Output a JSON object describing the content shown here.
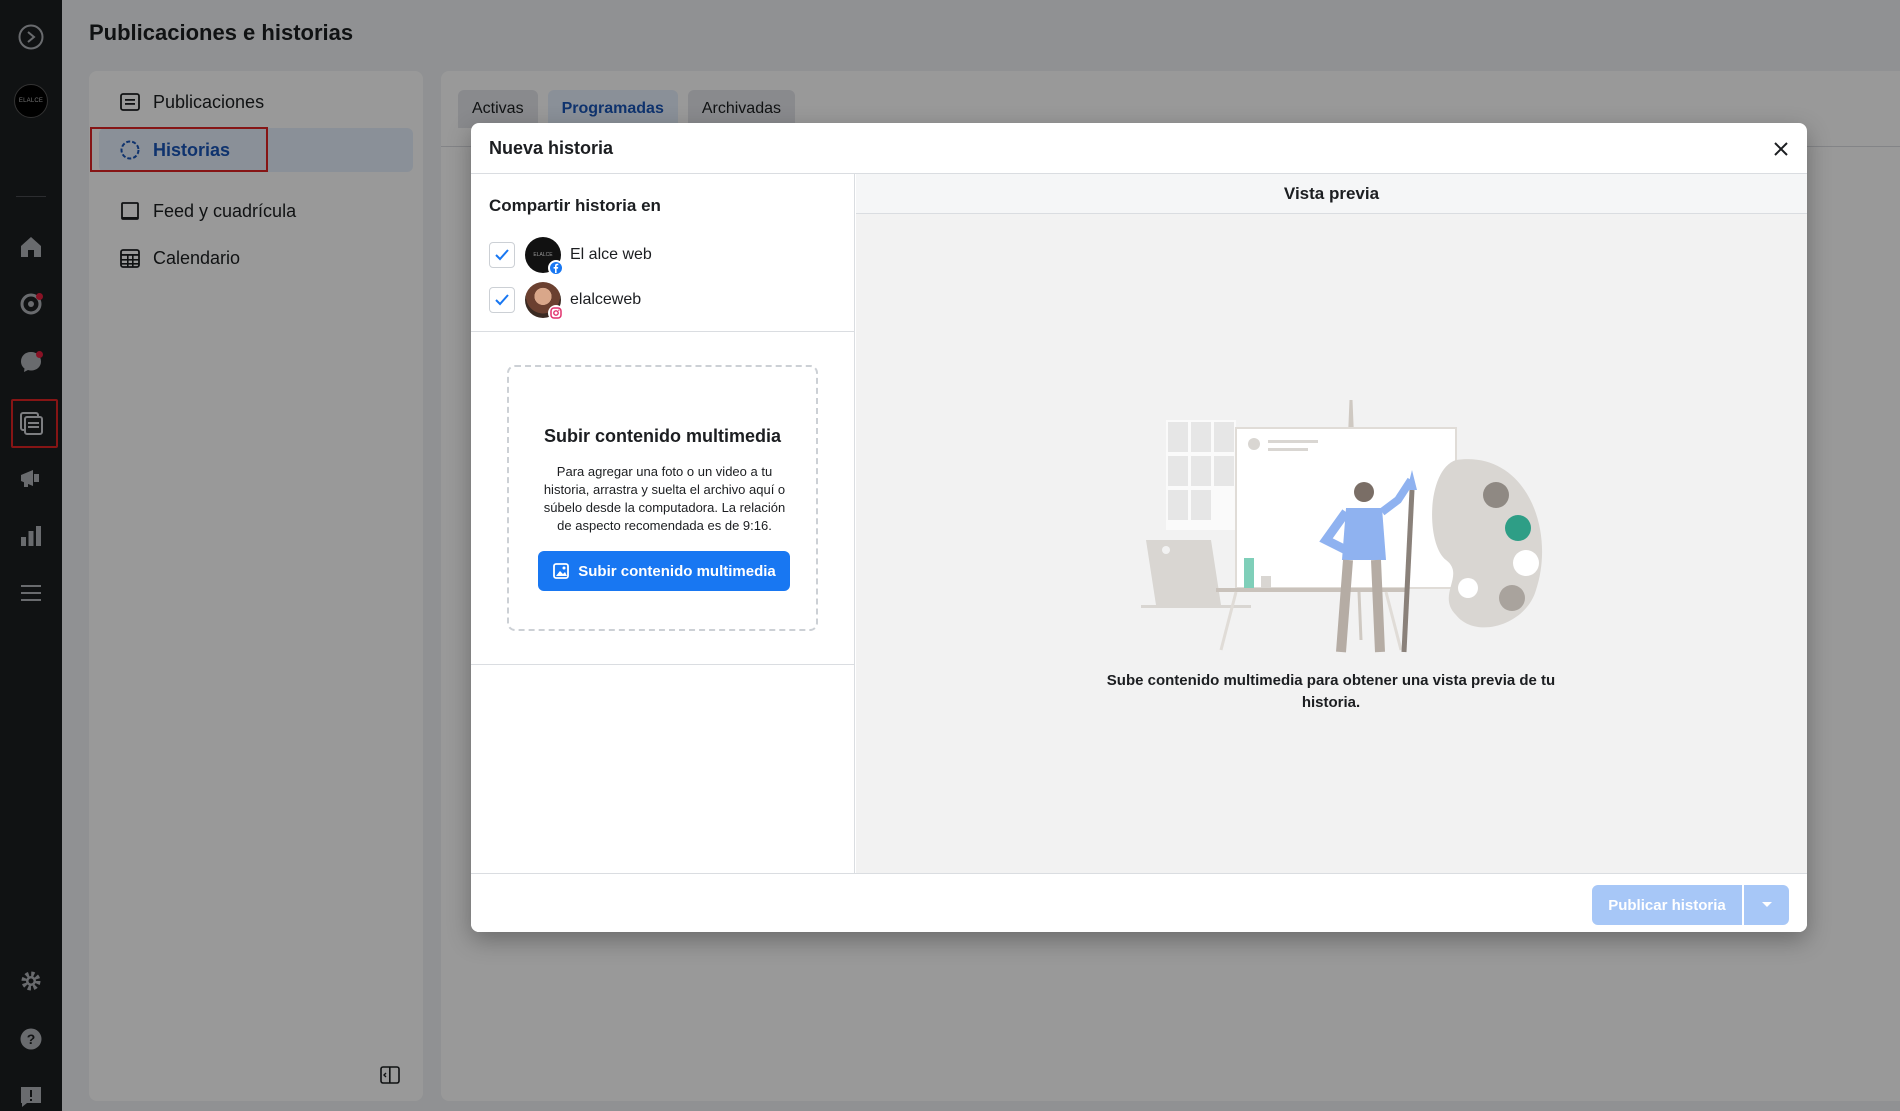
{
  "page": {
    "title": "Publicaciones e historias"
  },
  "rail": {
    "brand_avatar_text": "ELALCE",
    "icons": [
      "meta-logo-icon",
      "home-icon",
      "activity-icon",
      "messages-icon",
      "content-icon",
      "ads-icon",
      "insights-icon",
      "menu-icon",
      "settings-icon",
      "help-icon",
      "feedback-icon"
    ]
  },
  "nav": {
    "items": [
      {
        "label": "Publicaciones",
        "icon": "posts-icon"
      },
      {
        "label": "Historias",
        "icon": "stories-icon"
      },
      {
        "label": "Feed y cuadrícula",
        "icon": "feed-grid-icon"
      },
      {
        "label": "Calendario",
        "icon": "calendar-icon"
      }
    ],
    "active": "Historias"
  },
  "tabs": [
    {
      "label": "Activas"
    },
    {
      "label": "Programadas"
    },
    {
      "label": "Archivadas"
    }
  ],
  "modal": {
    "title": "Nueva historia",
    "share": {
      "title": "Compartir historia en",
      "accounts": [
        {
          "name": "El alce web",
          "platform": "facebook",
          "checked": true,
          "avatar_text": "ELALCE"
        },
        {
          "name": "elalceweb",
          "platform": "instagram",
          "checked": true
        }
      ]
    },
    "upload": {
      "title": "Subir contenido multimedia",
      "description": "Para agregar una foto o un video a tu historia, arrastra y suelta el archivo aquí o súbelo desde la computadora. La relación de aspecto recomendada es de 9:16.",
      "button": "Subir contenido multimedia"
    },
    "preview": {
      "title": "Vista previa",
      "message": "Sube contenido multimedia para obtener una vista previa de tu historia."
    },
    "footer": {
      "publish_label": "Publicar historia"
    }
  },
  "colors": {
    "accent": "#1877f2",
    "highlight": "#e02424",
    "rail_bg": "#1c1e21",
    "publish_disabled": "#a7c7f7"
  }
}
